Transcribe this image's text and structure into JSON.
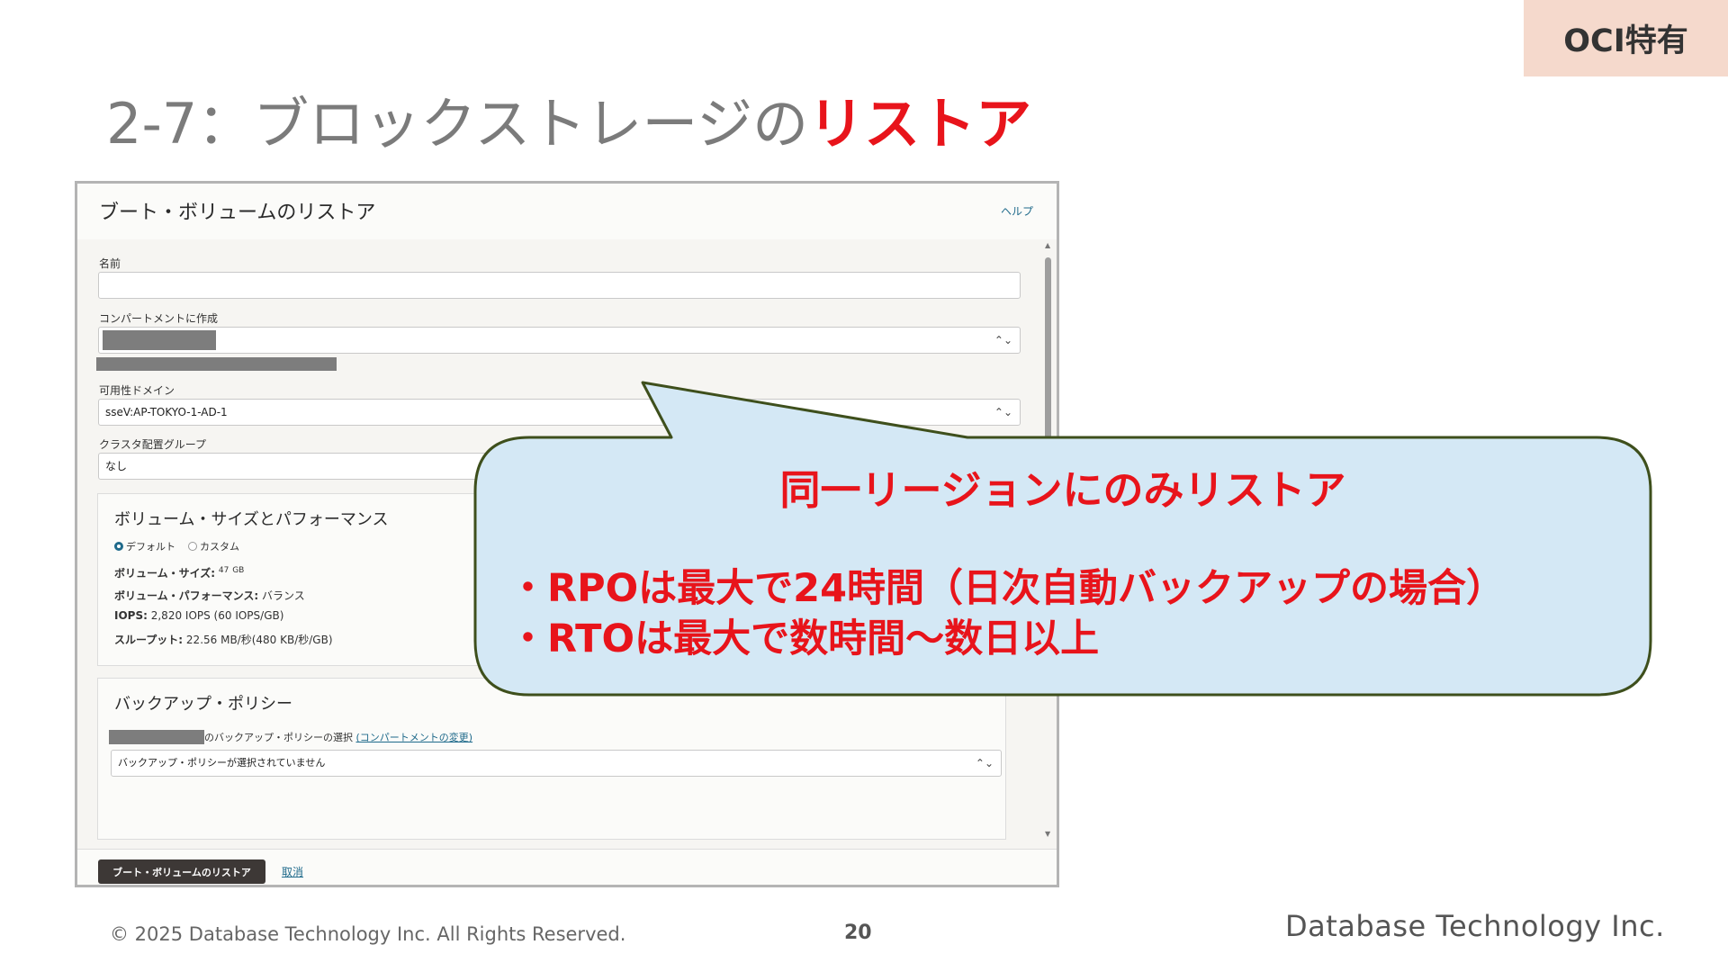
{
  "corner_tag": "OCI特有",
  "slide_title": {
    "prefix": "2-7：ブロックストレージの",
    "highlight": "リストア"
  },
  "dialog": {
    "title": "ブート・ボリュームのリストア",
    "help_link": "ヘルプ",
    "name_field": {
      "label": "名前",
      "value": ""
    },
    "compartment_field": {
      "label": "コンパートメントに作成"
    },
    "availability_domain_field": {
      "label": "可用性ドメイン",
      "value": "sseV:AP-TOKYO-1-AD-1"
    },
    "cluster_placement_group_field": {
      "label": "クラスタ配置グループ",
      "value": "なし"
    },
    "volume_section": {
      "title": "ボリューム・サイズとパフォーマンス",
      "radio_default": "デフォルト",
      "radio_custom": "カスタム",
      "size_label": "ボリューム・サイズ:",
      "size_value": "47",
      "size_unit": "GB",
      "performance_label": "ボリューム・パフォーマンス:",
      "performance_value": "バランス",
      "iops_label": "IOPS:",
      "iops_value": "2,820 IOPS (60 IOPS/GB)",
      "throughput_label": "スループット:",
      "throughput_value": "22.56 MB/秒(480 KB/秒/GB)"
    },
    "backup_section": {
      "title": "バックアップ・ポリシー",
      "select_text": "のバックアップ・ポリシーの選択",
      "change_compartment_link": "(コンパートメントの変更)",
      "policy_select_value": "バックアップ・ポリシーが選択されていません"
    },
    "primary_button": "ブート・ボリュームのリストア",
    "cancel_link": "取消"
  },
  "callout": {
    "heading": "同一リージョンにのみリストア",
    "bullets": [
      "・RPOは最大で24時間（日次自動バックアップの場合）",
      "・RTOは最大で数時間～数日以上"
    ],
    "fill_color": "#d4e8f5",
    "border_color": "#3e4f1c"
  },
  "footer": {
    "copyright": "© 2025 Database Technology Inc. All Rights Reserved.",
    "page_number": "20",
    "company_name": "Database Technology Inc."
  },
  "accent_color": "#e8141b"
}
